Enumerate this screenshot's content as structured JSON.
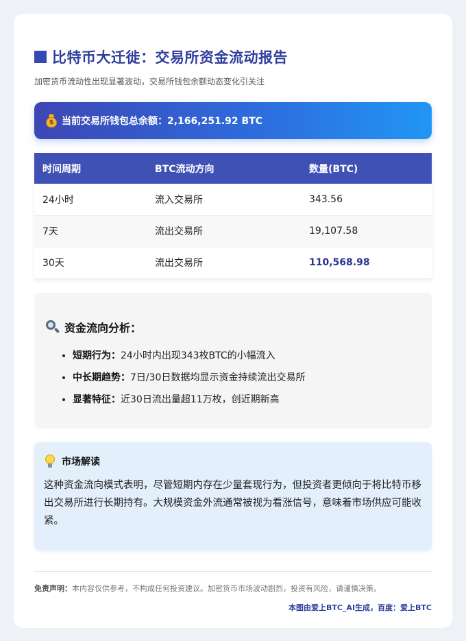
{
  "header": {
    "title": "比特币大迁徙：交易所资金流动报告",
    "subtitle": "加密货币流动性出现显著波动，交易所钱包余额动态变化引关注"
  },
  "banner": {
    "text": "当前交易所钱包总余额：2,166,251.92 BTC"
  },
  "table": {
    "headers": [
      "时间周期",
      "BTC流动方向",
      "数量(BTC)"
    ],
    "rows": [
      [
        "24小时",
        "流入交易所",
        "343.56"
      ],
      [
        "7天",
        "流出交易所",
        "19,107.58"
      ],
      [
        "30天",
        "流出交易所",
        "110,568.98"
      ]
    ]
  },
  "analysis": {
    "title": "资金流向分析：",
    "items": [
      {
        "label": "短期行为：",
        "text": "24小时内出现343枚BTC的小幅流入"
      },
      {
        "label": "中长期趋势：",
        "text": "7日/30日数据均显示资金持续流出交易所"
      },
      {
        "label": "显著特征：",
        "text": "近30日流出量超11万枚，创近期新高"
      }
    ]
  },
  "interpretation": {
    "title": "市场解读",
    "text": "这种资金流向模式表明，尽管短期内存在少量套现行为，但投资者更倾向于将比特币移出交易所进行长期持有。大规模资金外流通常被视为看涨信号，意味着市场供应可能收紧。"
  },
  "footer": {
    "disclaimer_label": "免责声明：",
    "disclaimer_text": "本内容仅供参考，不构成任何投资建议。加密货币市场波动剧烈，投资有风险，请谨慎决策。",
    "credit": "本图由爱上BTC_AI生成，百度：爱上BTC"
  },
  "icons": {
    "title": "square-icon",
    "banner": "money-bag-icon",
    "analysis": "magnifier-icon",
    "interpretation": "lightbulb-icon"
  },
  "colors": {
    "accent": "#3f51b5",
    "title": "#2f3e9e",
    "highlight": "#2a3490"
  }
}
